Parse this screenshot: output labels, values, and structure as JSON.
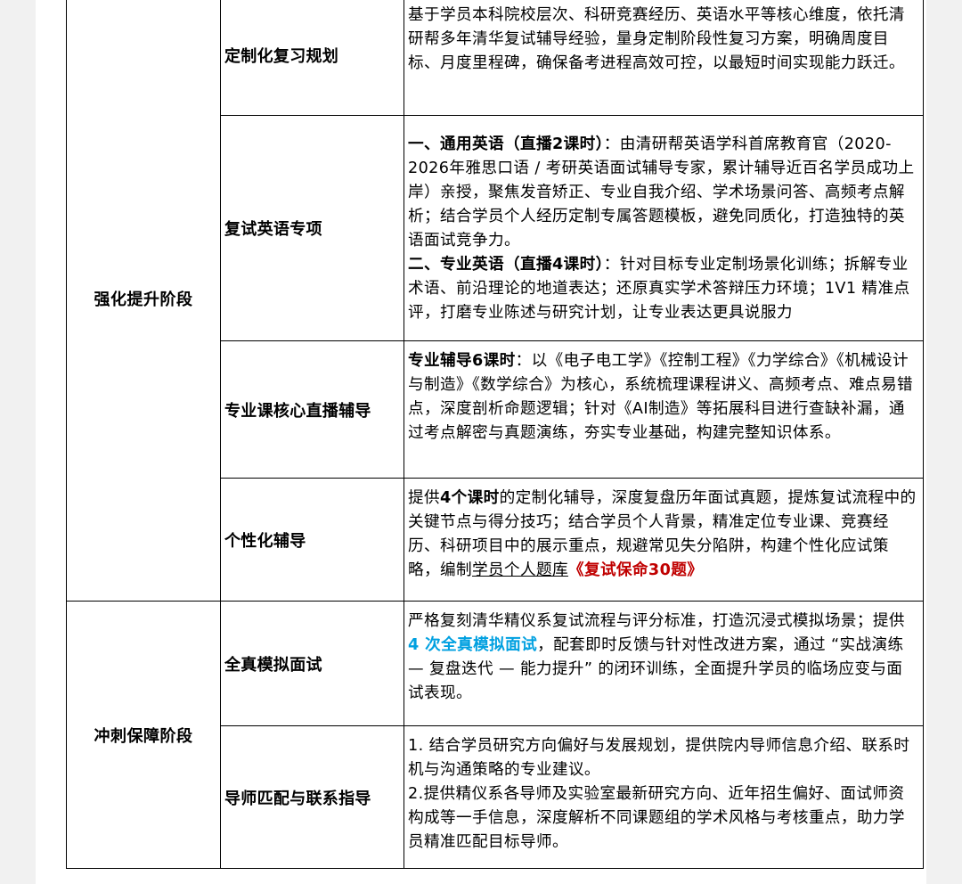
{
  "stages": [
    {
      "name": "强化提升阶段",
      "modules": [
        {
          "title": "定制化复习规划",
          "text": "基于学员本科院校层次、科研竞赛经历、英语水平等核心维度，依托清研帮多年清华复试辅导经验，量身定制阶段性复习方案，明确周度目标、月度里程碑，确保备考进程高效可控，以最短时间实现能力跃迁。"
        },
        {
          "title": "复试英语专项",
          "p1_bold": "一、通用英语（直播2课时）",
          "p1_rest": "：由清研帮英语学科首席教育官（2020-2026年雅思口语 / 考研英语面试辅导专家，累计辅导近百名学员成功上岸）亲授，聚焦发音矫正、专业自我介绍、学术场景问答、高频考点解析；结合学员个人经历定制专属答题模板，避免同质化，打造独特的英语面试竞争力。",
          "p2_bold": "二、专业英语（直播4课时）",
          "p2_rest": "：针对目标专业定制场景化训练；拆解专业术语、前沿理论的地道表达；还原真实学术答辩压力环境；1V1 精准点评，打磨专业陈述与研究计划，让专业表达更具说服力"
        },
        {
          "title": "专业课核心直播辅导",
          "bold": "专业辅导6课时",
          "rest": "：以《电子电工学》《控制工程》《力学综合》《机械设计与制造》《数学综合》为核心，系统梳理课程讲义、高频考点、难点易错点，深度剖析命题逻辑；针对《AI制造》等拓展科目进行查缺补漏，通过考点解密与真题演练，夯实专业基础，构建完整知识体系。"
        },
        {
          "title": "个性化辅导",
          "pre": "提供",
          "bold": "4个课时",
          "mid": "的定制化辅导，深度复盘历年面试真题，提炼复试流程中的关键节点与得分技巧；结合学员个人背景，精准定位专业课、竞赛经历、科研项目中的展示重点，规避常见失分陷阱，构建个性化应试策略，编制",
          "underline": "学员个人题库",
          "red": "《复试保命30题》"
        }
      ]
    },
    {
      "name": "冲刺保障阶段",
      "modules": [
        {
          "title": "全真模拟面试",
          "pre": "严格复刻清华精仪系复试流程与评分标准，打造沉浸式模拟场景；提供 ",
          "blue": "4 次全真模拟面试",
          "rest": "，配套即时反馈与针对性改进方案，通过 “实战演练 — 复盘迭代 — 能力提升” 的闭环训练，全面提升学员的临场应变与面试表现。"
        },
        {
          "title": "导师匹配与联系指导",
          "p1": "1. 结合学员研究方向偏好与发展规划，提供院内导师信息介绍、联系时机与沟通策略的专业建议。",
          "p2": "2.提供精仪系各导师及实验室最新研究方向、近年招生偏好、面试师资构成等一手信息，深度解析不同课题组的学术风格与考核重点，助力学员精准匹配目标导师。"
        }
      ]
    }
  ]
}
